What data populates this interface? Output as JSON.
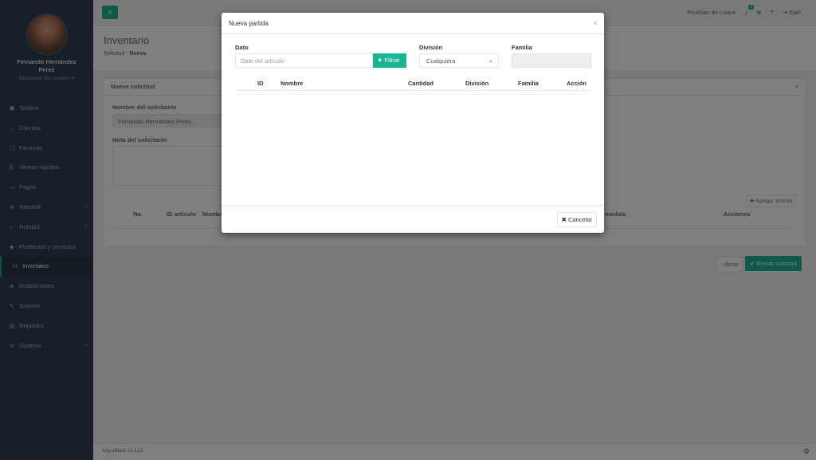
{
  "user": {
    "name": "Fernando Hernández Perez",
    "options": "Opciones de usuario ▾"
  },
  "sidebar": {
    "items": [
      {
        "icon": "☗",
        "label": "Tablero"
      },
      {
        "icon": "☺",
        "label": "Clientes"
      },
      {
        "icon": "▢",
        "label": "Facturas"
      },
      {
        "icon": "$",
        "label": "Ventas rápidas"
      },
      {
        "icon": "▭",
        "label": "Pagos"
      },
      {
        "icon": "✲",
        "label": "Network",
        "arrow": "‹"
      },
      {
        "icon": "≈",
        "label": "Hotspot",
        "arrow": "‹"
      },
      {
        "icon": "◆",
        "label": "Productos y servicios"
      },
      {
        "icon": "⚇",
        "label": "Inventario"
      },
      {
        "icon": "◈",
        "label": "Instalaciones"
      },
      {
        "icon": "✎",
        "label": "Soporte"
      },
      {
        "icon": "▤",
        "label": "Reportes"
      },
      {
        "icon": "⚙",
        "label": "Sistema",
        "arrow": "‹"
      }
    ]
  },
  "topbar": {
    "menu_icon": "≡",
    "company": "Pruebas de Livaur",
    "notif_count": "1",
    "bell": "♪",
    "globe": "⊕",
    "help": "?",
    "logout_icon": "⇥",
    "logout": "Salir"
  },
  "page": {
    "title": "Inventario",
    "crumb1": "Solicitud",
    "sep": "/",
    "crumb2": "Nueva"
  },
  "form": {
    "box_title": "Nueva solicitud",
    "close": "×",
    "applicant_label": "Nombre del solicitante",
    "applicant_value": "Fernando Hernández Perez",
    "note_label": "Nota del solicitante",
    "add_item": "✚ Agregar artículo",
    "headers": [
      "No.",
      "ID artículo",
      "Nombre",
      "e medida",
      "Acciones"
    ]
  },
  "actions": {
    "back": "‹ Atras",
    "send": "✔ Enviar solicitud"
  },
  "footer": {
    "version": "ArgusBlack v2.3.12",
    "icon": "⚙"
  },
  "modal": {
    "title": "Nueva partida",
    "close": "×",
    "dato_label": "Dato",
    "dato_placeholder": "Dato del artículo",
    "filter": "▼ Filtrar",
    "division_label": "División",
    "division_value": "Cualquiera",
    "familia_label": "Familia",
    "headers": [
      "ID",
      "Nombre",
      "Cantidad",
      "División",
      "Familia",
      "Acción"
    ],
    "cancel": "✖ Cancelar"
  }
}
